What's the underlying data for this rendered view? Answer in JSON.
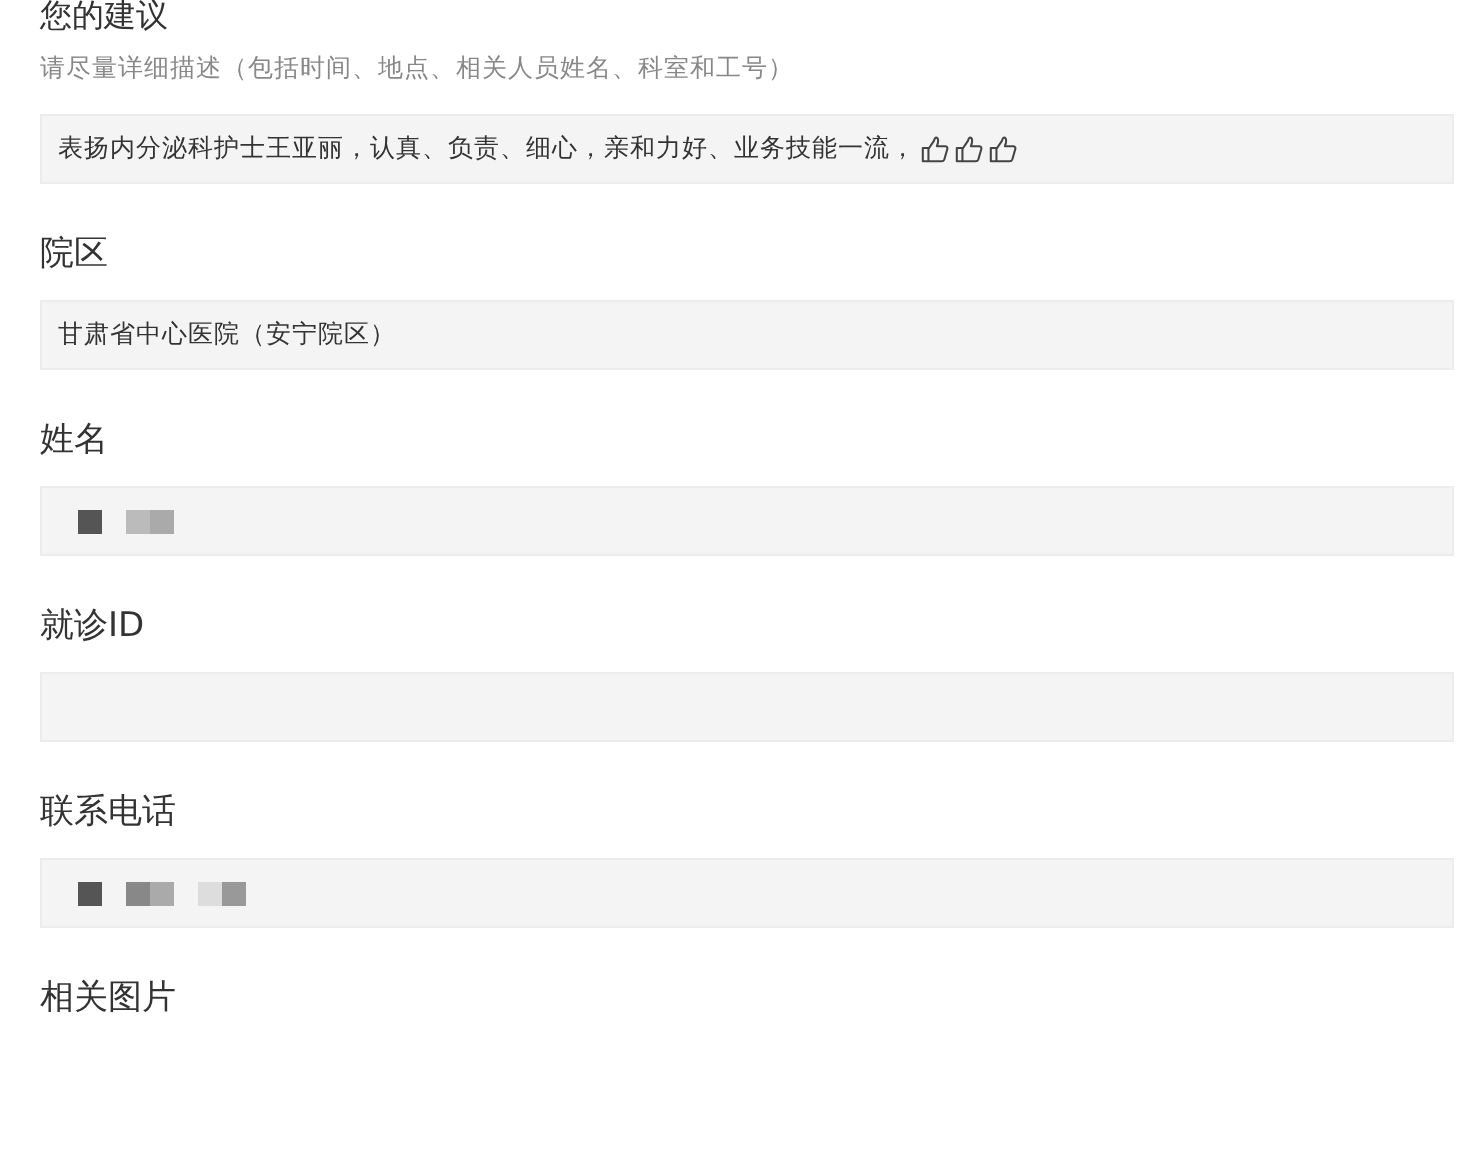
{
  "title": "您的建议",
  "hint": "请尽量详细描述（包括时间、地点、相关人员姓名、科室和工号）",
  "suggestion": {
    "value": "表扬内分泌科护士王亚丽，认真、负责、细心，亲和力好、业务技能一流，",
    "icons": [
      {
        "kind": "thumbs-up"
      },
      {
        "kind": "thumbs-up"
      },
      {
        "kind": "thumbs-up"
      }
    ]
  },
  "fields": [
    {
      "label": "院区",
      "kind": "text",
      "value": "甘肃省中心医院（安宁院区）"
    },
    {
      "label": "姓名",
      "kind": "redacted"
    },
    {
      "label": "就诊ID",
      "kind": "empty"
    },
    {
      "label": "联系电话",
      "kind": "redacted"
    }
  ],
  "next_section": "相关图片"
}
